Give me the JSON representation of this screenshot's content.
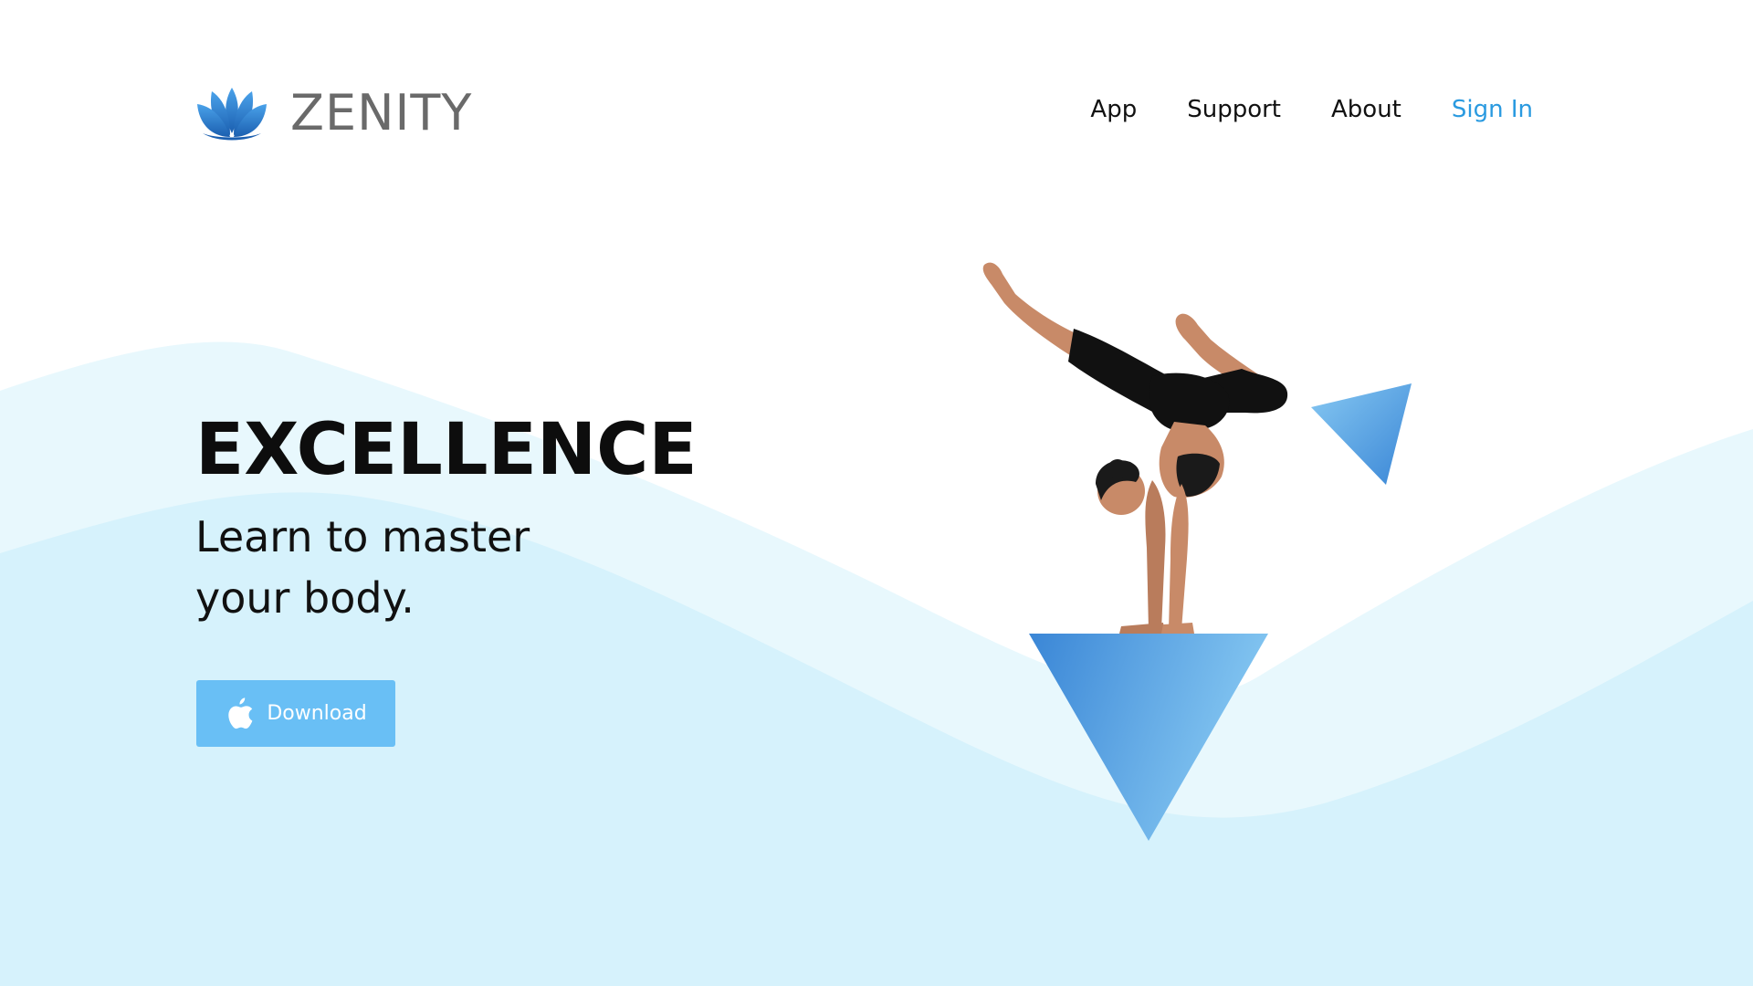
{
  "brand": {
    "name": "ZENITY",
    "logo_icon": "lotus-icon"
  },
  "nav": {
    "items": [
      {
        "label": "App"
      },
      {
        "label": "Support"
      },
      {
        "label": "About"
      }
    ],
    "signin_label": "Sign In"
  },
  "hero": {
    "title": "EXCELLENCE",
    "subtitle": "Learn to master your body.",
    "download_label": "Download",
    "download_icon": "apple-icon"
  },
  "colors": {
    "accent": "#2a9ae0",
    "button": "#69bff5",
    "wave_light": "#e8f8fd",
    "wave_base": "#d6f2fc",
    "triangle_dark": "#3a86d6",
    "triangle_light": "#86c8f2"
  }
}
